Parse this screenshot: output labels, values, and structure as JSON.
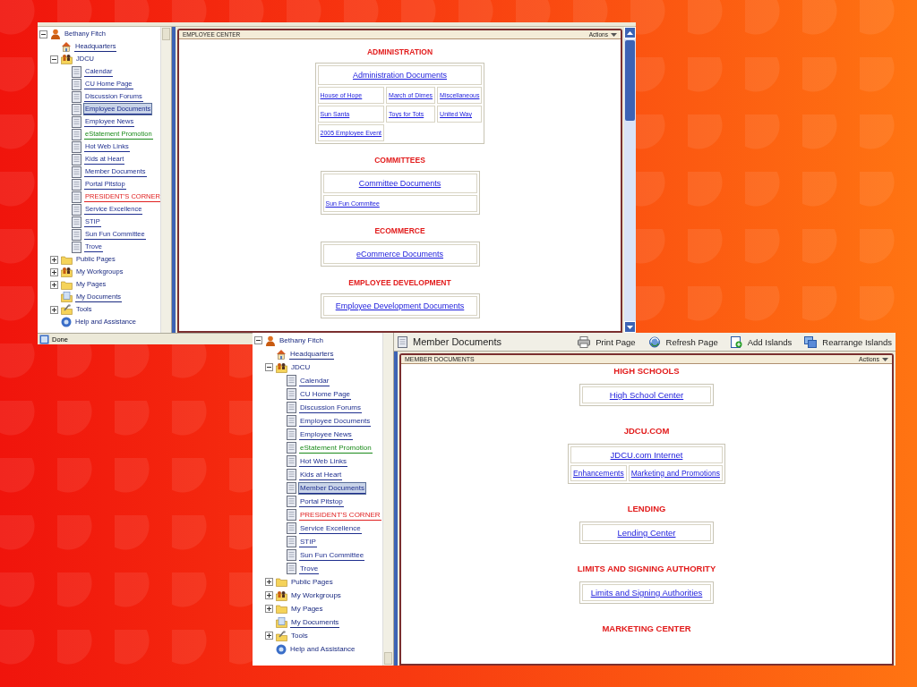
{
  "windows": [
    {
      "panel_title": "EMPLOYEE CENTER",
      "actions": "Actions",
      "status": "Done",
      "tree": [
        {
          "label": "Bethany Fitch",
          "kind": "user",
          "expanded": true,
          "children": [
            {
              "label": "Headquarters",
              "kind": "house"
            },
            {
              "label": "JDCU",
              "kind": "group",
              "expanded": true,
              "children": [
                {
                  "label": "Calendar",
                  "kind": "page",
                  "selected": false,
                  "color": "#1f2f8f"
                },
                {
                  "label": "CU Home Page",
                  "kind": "page",
                  "selected": false,
                  "color": "#1f2f8f"
                },
                {
                  "label": "Discussion Forums",
                  "kind": "page",
                  "selected": false,
                  "color": "#1f2f8f"
                },
                {
                  "label": "Employee Documents",
                  "kind": "page",
                  "selected": true,
                  "color": "#1f2f8f"
                },
                {
                  "label": "Employee News",
                  "kind": "page",
                  "selected": false,
                  "color": "#1f2f8f"
                },
                {
                  "label": "eStatement Promotion",
                  "kind": "page",
                  "selected": false,
                  "color": "#1a8a1a"
                },
                {
                  "label": "Hot Web Links",
                  "kind": "page",
                  "selected": false,
                  "color": "#1f2f8f"
                },
                {
                  "label": "Kids at Heart",
                  "kind": "page",
                  "selected": false,
                  "color": "#1f2f8f"
                },
                {
                  "label": "Member Documents",
                  "kind": "page",
                  "selected": false,
                  "color": "#1f2f8f"
                },
                {
                  "label": "Portal Pitstop",
                  "kind": "page",
                  "selected": false,
                  "color": "#1f2f8f"
                },
                {
                  "label": "PRESIDENT'S CORNER",
                  "kind": "page",
                  "selected": false,
                  "color": "#e02020"
                },
                {
                  "label": "Service Excellence",
                  "kind": "page",
                  "selected": false,
                  "color": "#1f2f8f"
                },
                {
                  "label": "STIP",
                  "kind": "page",
                  "selected": false,
                  "color": "#1f2f8f"
                },
                {
                  "label": "Sun Fun Committee",
                  "kind": "page",
                  "selected": false,
                  "color": "#1f2f8f"
                },
                {
                  "label": "Trove",
                  "kind": "page",
                  "selected": false,
                  "color": "#1f2f8f"
                }
              ]
            },
            {
              "label": "Public Pages",
              "kind": "folder",
              "expanded": false
            },
            {
              "label": "My Workgroups",
              "kind": "group",
              "expanded": false
            },
            {
              "label": "My Pages",
              "kind": "folder",
              "expanded": false
            },
            {
              "label": "My Documents",
              "kind": "docs"
            },
            {
              "label": "Tools",
              "kind": "tools",
              "expanded": false
            },
            {
              "label": "Help and Assistance",
              "kind": "help"
            }
          ]
        }
      ],
      "sections": [
        {
          "heading": "ADMINISTRATION",
          "link": "Administration Documents",
          "rows": [
            [
              "House of Hope",
              "March of Dimes",
              "Miscellaneous"
            ],
            [
              "Sun Santa",
              "Toys for Tots",
              "United Way"
            ],
            [
              "2005 Employee Event"
            ]
          ]
        },
        {
          "heading": "COMMITTEES",
          "link": "Committee Documents",
          "rows": [
            [
              "Sun Fun Commitee"
            ]
          ]
        },
        {
          "heading": "ECOMMERCE",
          "link": "eCommerce Documents"
        },
        {
          "heading": "EMPLOYEE DEVELOPMENT",
          "link": "Employee Development Documents"
        }
      ]
    },
    {
      "page_title": "Member Documents",
      "panel_title": "MEMBER DOCUMENTS",
      "actions": "Actions",
      "toolbar": [
        {
          "label": "Print Page",
          "kind": "print"
        },
        {
          "label": "Refresh Page",
          "kind": "refresh"
        },
        {
          "label": "Add Islands",
          "kind": "add"
        },
        {
          "label": "Rearrange Islands",
          "kind": "rearrange"
        }
      ],
      "tree": [
        {
          "label": "Bethany Fitch",
          "kind": "user",
          "expanded": true,
          "children": [
            {
              "label": "Headquarters",
              "kind": "house"
            },
            {
              "label": "JDCU",
              "kind": "group",
              "expanded": true,
              "children": [
                {
                  "label": "Calendar",
                  "kind": "page",
                  "selected": false,
                  "color": "#1f2f8f"
                },
                {
                  "label": "CU Home Page",
                  "kind": "page",
                  "selected": false,
                  "color": "#1f2f8f"
                },
                {
                  "label": "Discussion Forums",
                  "kind": "page",
                  "selected": false,
                  "color": "#1f2f8f"
                },
                {
                  "label": "Employee Documents",
                  "kind": "page",
                  "selected": false,
                  "color": "#1f2f8f"
                },
                {
                  "label": "Employee News",
                  "kind": "page",
                  "selected": false,
                  "color": "#1f2f8f"
                },
                {
                  "label": "eStatement Promotion",
                  "kind": "page",
                  "selected": false,
                  "color": "#1a8a1a"
                },
                {
                  "label": "Hot Web Links",
                  "kind": "page",
                  "selected": false,
                  "color": "#1f2f8f"
                },
                {
                  "label": "Kids at Heart",
                  "kind": "page",
                  "selected": false,
                  "color": "#1f2f8f"
                },
                {
                  "label": "Member Documents",
                  "kind": "page",
                  "selected": true,
                  "color": "#1f2f8f"
                },
                {
                  "label": "Portal Pitstop",
                  "kind": "page",
                  "selected": false,
                  "color": "#1f2f8f"
                },
                {
                  "label": "PRESIDENT'S CORNER",
                  "kind": "page",
                  "selected": false,
                  "color": "#e02020"
                },
                {
                  "label": "Service Excellence",
                  "kind": "page",
                  "selected": false,
                  "color": "#1f2f8f"
                },
                {
                  "label": "STIP",
                  "kind": "page",
                  "selected": false,
                  "color": "#1f2f8f"
                },
                {
                  "label": "Sun Fun Committee",
                  "kind": "page",
                  "selected": false,
                  "color": "#1f2f8f"
                },
                {
                  "label": "Trove",
                  "kind": "page",
                  "selected": false,
                  "color": "#1f2f8f"
                }
              ]
            },
            {
              "label": "Public Pages",
              "kind": "folder",
              "expanded": false
            },
            {
              "label": "My Workgroups",
              "kind": "group",
              "expanded": false
            },
            {
              "label": "My Pages",
              "kind": "folder",
              "expanded": false
            },
            {
              "label": "My Documents",
              "kind": "docs"
            },
            {
              "label": "Tools",
              "kind": "tools",
              "expanded": false
            },
            {
              "label": "Help and Assistance",
              "kind": "help"
            }
          ]
        }
      ],
      "sections": [
        {
          "heading": "HIGH SCHOOLS",
          "link": "High School Center"
        },
        {
          "heading": "JDCU.COM",
          "link": "JDCU.com Internet",
          "rows": [
            [
              "Enhancements",
              "Marketing and Promotions"
            ]
          ]
        },
        {
          "heading": "LENDING",
          "link": "Lending Center"
        },
        {
          "heading": "LIMITS AND SIGNING AUTHORITY",
          "link": "Limits and Signing Authorities"
        },
        {
          "heading": "MARKETING CENTER"
        }
      ]
    }
  ]
}
